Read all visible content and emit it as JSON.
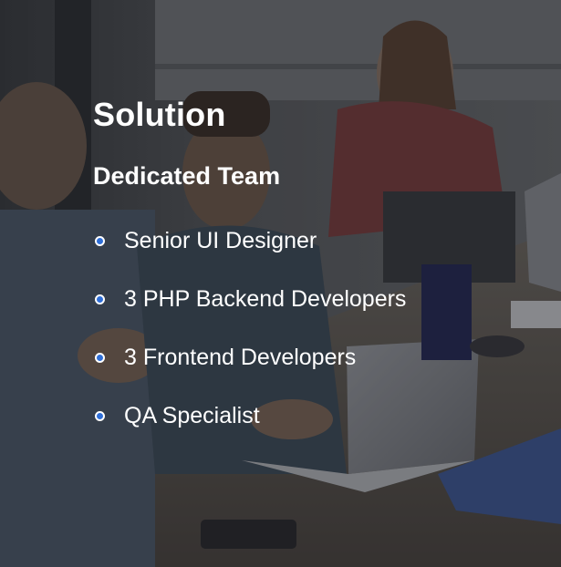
{
  "section": {
    "title": "Solution",
    "subtitle": "Dedicated Team"
  },
  "team": {
    "items": [
      {
        "label": "Senior UI Designer",
        "icon": "bullet-dot-icon"
      },
      {
        "label": "3 PHP Backend Developers",
        "icon": "bullet-dot-icon"
      },
      {
        "label": "3 Frontend Developers",
        "icon": "bullet-dot-icon"
      },
      {
        "label": "QA Specialist",
        "icon": "bullet-dot-icon"
      }
    ]
  },
  "colors": {
    "text": "#ffffff",
    "bullet": "#2f6fd8",
    "overlay": "#0f0f14"
  }
}
